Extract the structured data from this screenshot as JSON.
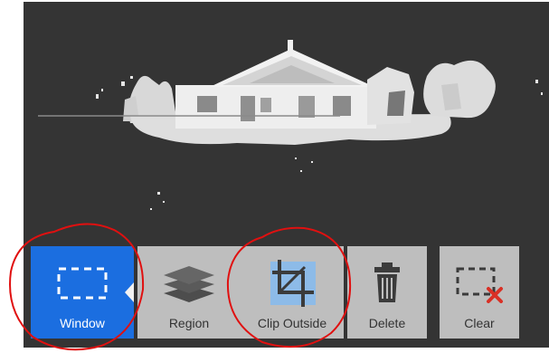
{
  "toolbar": {
    "tools": [
      {
        "label": "Window",
        "icon": "window-select-icon",
        "active": true
      },
      {
        "label": "Region",
        "icon": "layers-icon",
        "active": false
      },
      {
        "label": "Clip Outside",
        "icon": "crop-icon",
        "active": false
      },
      {
        "label": "Delete",
        "icon": "trash-icon",
        "active": false
      },
      {
        "label": "Clear",
        "icon": "clear-selection-icon",
        "active": false
      }
    ]
  },
  "colors": {
    "viewport_bg": "#343434",
    "active_tool_bg": "#1b6ee0",
    "tool_bg": "#bebebe",
    "annotation": "#e01010",
    "clear_x": "#d93025"
  }
}
